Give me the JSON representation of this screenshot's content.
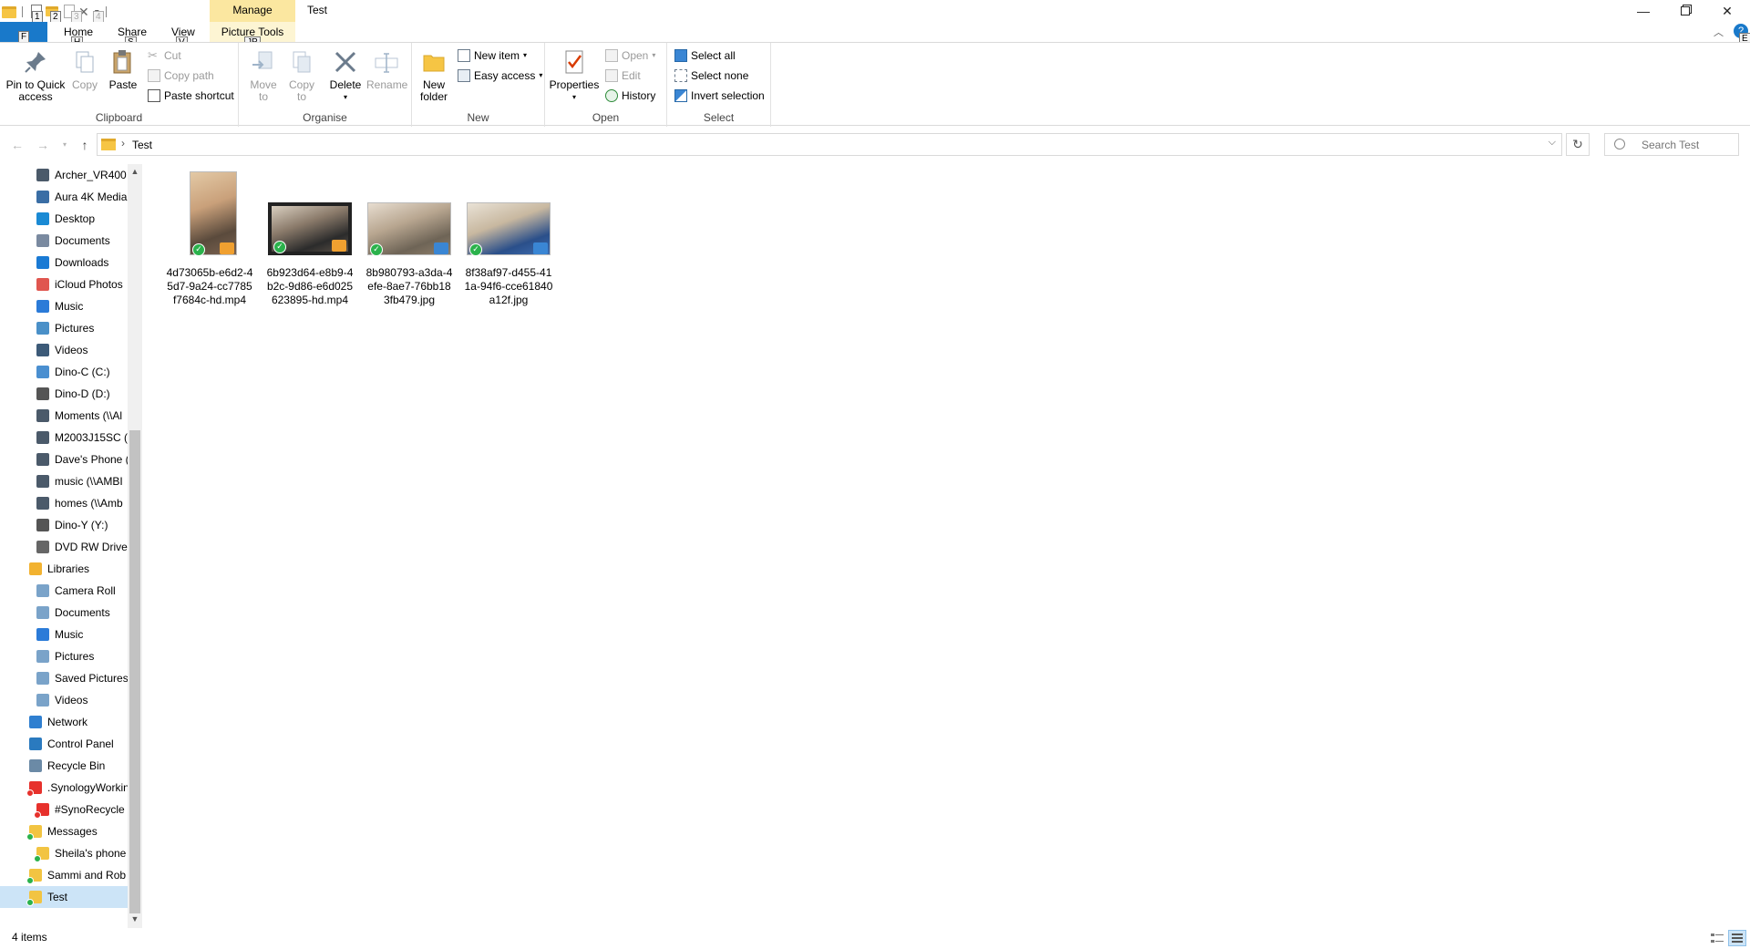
{
  "window": {
    "title": "Test",
    "context_tab_header": "Manage",
    "controls": [
      "minimize",
      "restore",
      "close"
    ]
  },
  "quick_access_toolbar": {
    "keytips": [
      "1",
      "2",
      "3",
      "4"
    ]
  },
  "ribbon_tabs": {
    "file": {
      "label": "",
      "keytip": "F"
    },
    "home": {
      "label": "Home",
      "keytip": "H"
    },
    "share": {
      "label": "Share",
      "keytip": "S"
    },
    "view": {
      "label": "View",
      "keytip": "V"
    },
    "picture_tools": {
      "label": "Picture Tools",
      "keytip": "JP"
    },
    "help_keytip": "E"
  },
  "ribbon": {
    "clipboard": {
      "label": "Clipboard",
      "pin": "Pin to Quick access",
      "copy": "Copy",
      "paste": "Paste",
      "cut": "Cut",
      "copy_path": "Copy path",
      "paste_shortcut": "Paste shortcut"
    },
    "organise": {
      "label": "Organise",
      "move_to": "Move to",
      "copy_to": "Copy to",
      "delete": "Delete",
      "rename": "Rename"
    },
    "new": {
      "label": "New",
      "new_folder": "New folder",
      "new_item": "New item",
      "easy_access": "Easy access"
    },
    "open": {
      "label": "Open",
      "properties": "Properties",
      "open": "Open",
      "edit": "Edit",
      "history": "History"
    },
    "select": {
      "label": "Select",
      "select_all": "Select all",
      "select_none": "Select none",
      "invert_selection": "Invert selection"
    }
  },
  "address": {
    "path": "Test",
    "search_placeholder": "Search Test"
  },
  "nav_items": [
    {
      "label": "Archer_VR400",
      "indent": 1,
      "icon": "network-drive-icon"
    },
    {
      "label": "Aura 4K Media",
      "indent": 1,
      "icon": "media-device-icon"
    },
    {
      "label": "Desktop",
      "indent": 1,
      "icon": "desktop-icon"
    },
    {
      "label": "Documents",
      "indent": 1,
      "icon": "documents-icon"
    },
    {
      "label": "Downloads",
      "indent": 1,
      "icon": "downloads-icon"
    },
    {
      "label": "iCloud Photos",
      "indent": 1,
      "icon": "icloud-photos-icon"
    },
    {
      "label": "Music",
      "indent": 1,
      "icon": "music-icon"
    },
    {
      "label": "Pictures",
      "indent": 1,
      "icon": "pictures-icon"
    },
    {
      "label": "Videos",
      "indent": 1,
      "icon": "videos-icon"
    },
    {
      "label": "Dino-C (C:)",
      "indent": 1,
      "icon": "system-drive-icon"
    },
    {
      "label": "Dino-D (D:)",
      "indent": 1,
      "icon": "drive-icon"
    },
    {
      "label": "Moments (\\\\Al",
      "indent": 1,
      "icon": "network-drive-icon"
    },
    {
      "label": "M2003J15SC (\\",
      "indent": 1,
      "icon": "network-drive-icon"
    },
    {
      "label": "Dave's Phone (",
      "indent": 1,
      "icon": "network-drive-icon"
    },
    {
      "label": "music (\\\\AMBI",
      "indent": 1,
      "icon": "network-drive-icon"
    },
    {
      "label": "homes (\\\\Amb",
      "indent": 1,
      "icon": "network-drive-icon"
    },
    {
      "label": "Dino-Y (Y:)",
      "indent": 1,
      "icon": "drive-icon"
    },
    {
      "label": "DVD RW Drive",
      "indent": 1,
      "icon": "dvd-drive-icon"
    },
    {
      "label": "Libraries",
      "indent": 0,
      "icon": "libraries-icon"
    },
    {
      "label": "Camera Roll",
      "indent": 1,
      "icon": "library-folder-icon"
    },
    {
      "label": "Documents",
      "indent": 1,
      "icon": "library-folder-icon"
    },
    {
      "label": "Music",
      "indent": 1,
      "icon": "music-icon"
    },
    {
      "label": "Pictures",
      "indent": 1,
      "icon": "library-folder-icon"
    },
    {
      "label": "Saved Pictures",
      "indent": 1,
      "icon": "library-folder-icon"
    },
    {
      "label": "Videos",
      "indent": 1,
      "icon": "library-folder-icon"
    },
    {
      "label": "Network",
      "indent": 0,
      "icon": "network-icon"
    },
    {
      "label": "Control Panel",
      "indent": 0,
      "icon": "control-panel-icon"
    },
    {
      "label": "Recycle Bin",
      "indent": 0,
      "icon": "recycle-bin-icon"
    },
    {
      "label": ".SynologyWorkin",
      "indent": 0,
      "icon": "sync-error-folder-icon"
    },
    {
      "label": "#SynoRecycle",
      "indent": 1,
      "icon": "sync-error-folder-icon"
    },
    {
      "label": "Messages",
      "indent": 0,
      "icon": "synced-folder-icon"
    },
    {
      "label": "Sheila's phone",
      "indent": 1,
      "icon": "synced-folder-icon"
    },
    {
      "label": "Sammi and Rob",
      "indent": 0,
      "icon": "synced-folder-icon"
    },
    {
      "label": "Test",
      "indent": 0,
      "icon": "synced-folder-icon",
      "selected": true
    }
  ],
  "files": [
    {
      "name": "4d73065b-e6d2-45d7-9a24-cc7785f7684c-hd.mp4",
      "lines": [
        "4d73065b-e6d2-4",
        "5d7-9a24-cc7785",
        "f7684c-hd.mp4"
      ],
      "type": "video",
      "orientation": "portrait"
    },
    {
      "name": "6b923d64-e8b9-4b2c-9d86-e6d025623895-hd.mp4",
      "lines": [
        "6b923d64-e8b9-4",
        "b2c-9d86-e6d025",
        "623895-hd.mp4"
      ],
      "type": "video",
      "orientation": "landscape"
    },
    {
      "name": "8b980793-a3da-4efe-8ae7-76bb183fb479.jpg",
      "lines": [
        "8b980793-a3da-4",
        "efe-8ae7-76bb18",
        "3fb479.jpg"
      ],
      "type": "image",
      "orientation": "landscape"
    },
    {
      "name": "8f38af97-d455-411a-94f6-cce61840a12f.jpg",
      "lines": [
        "8f38af97-d455-41",
        "1a-94f6-cce61840",
        "a12f.jpg"
      ],
      "type": "image",
      "orientation": "landscape"
    }
  ],
  "status": {
    "item_count": "4 items"
  },
  "colors": {
    "file_tab": "#1979ca",
    "manage_tab": "#fbe7a0",
    "selection": "#cce4f7",
    "sync_ok": "#2bb24c"
  }
}
